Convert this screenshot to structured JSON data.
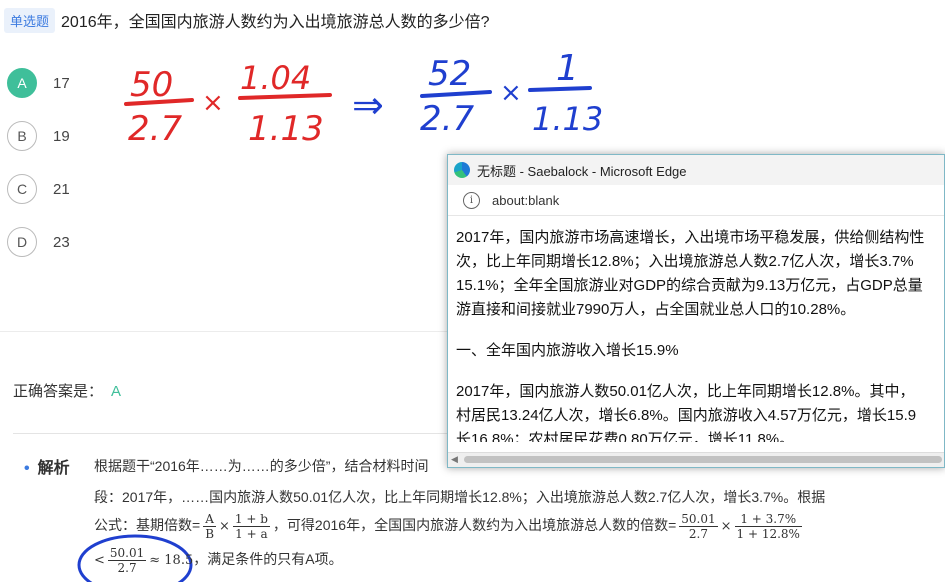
{
  "question": {
    "tag": "单选题",
    "text": "2016年，全国国内旅游人数约为入出境旅游总人数的多少倍?"
  },
  "options": [
    {
      "letter": "A",
      "value": "17",
      "selected": true
    },
    {
      "letter": "B",
      "value": "19",
      "selected": false
    },
    {
      "letter": "C",
      "value": "21",
      "selected": false
    },
    {
      "letter": "D",
      "value": "23",
      "selected": false
    }
  ],
  "handwriting": {
    "red": {
      "frac1_num": "50",
      "frac1_den": "2.7",
      "times": "×",
      "frac2_num": "1.04",
      "frac2_den": "1.13"
    },
    "blue": {
      "arrow": "⇒",
      "frac1_num": "52",
      "frac1_den": "2.7",
      "times": "×",
      "frac2_num": "1",
      "frac2_den": "1.13"
    }
  },
  "answer": {
    "label": "正确答案是：",
    "letter": "A"
  },
  "analysis": {
    "title": "解析",
    "line1": "根据题干“2016年……为……的多少倍”，结合材料时间",
    "line2": "段：2017年，……国内旅游人数50.01亿人次，比上年同期增长12.8%；入出境旅游总人数2.7亿人次，增长3.7%。根据",
    "line3_a": "公式：基期倍数=",
    "f_ab_n": "A",
    "f_ab_d": "B",
    "times": "×",
    "f_b_n": "1 + b",
    "f_b_d": "1 + a",
    "line3_b": "，可得2016年，全国国内旅游人数约为入出境旅游总人数的倍数=",
    "f1_n": "50.01",
    "f1_d": "2.7",
    "f2_n": "1 + 3.7%",
    "f2_d": "1 + 12.8%",
    "line4_lt": "<",
    "f3_n": "50.01",
    "f3_d": "2.7",
    "approx": "≈ 18.5",
    "line4_b": "，满足条件的只有A项。"
  },
  "browser": {
    "title": "无标题 - Saebalock - Microsoft Edge",
    "address": "about:blank",
    "paragraphs": [
      "2017年，国内旅游市场高速增长，入出境市场平稳发展，供给侧结构性",
      "次，比上年同期增长12.8%；入出境旅游总人数2.7亿人次，增长3.7%",
      "15.1%；全年全国旅游业对GDP的综合贡献为9.13万亿元，占GDP总量",
      "游直接和间接就业7990万人，占全国就业总人口的10.28%。",
      "一、全年国内旅游收入增长15.9%",
      "2017年，国内旅游人数50.01亿人次，比上年同期增长12.8%。其中，",
      "村居民13.24亿人次，增长6.8%。国内旅游收入4.57万亿元，增长15.9",
      "长16.8%；农村居民花费0.80万亿元，增长11.8%。"
    ]
  },
  "colors": {
    "accent_green": "#3fbf9a",
    "tag_blue": "#3c7be0",
    "ink_red": "#e02828",
    "ink_blue": "#1f3fcf"
  }
}
